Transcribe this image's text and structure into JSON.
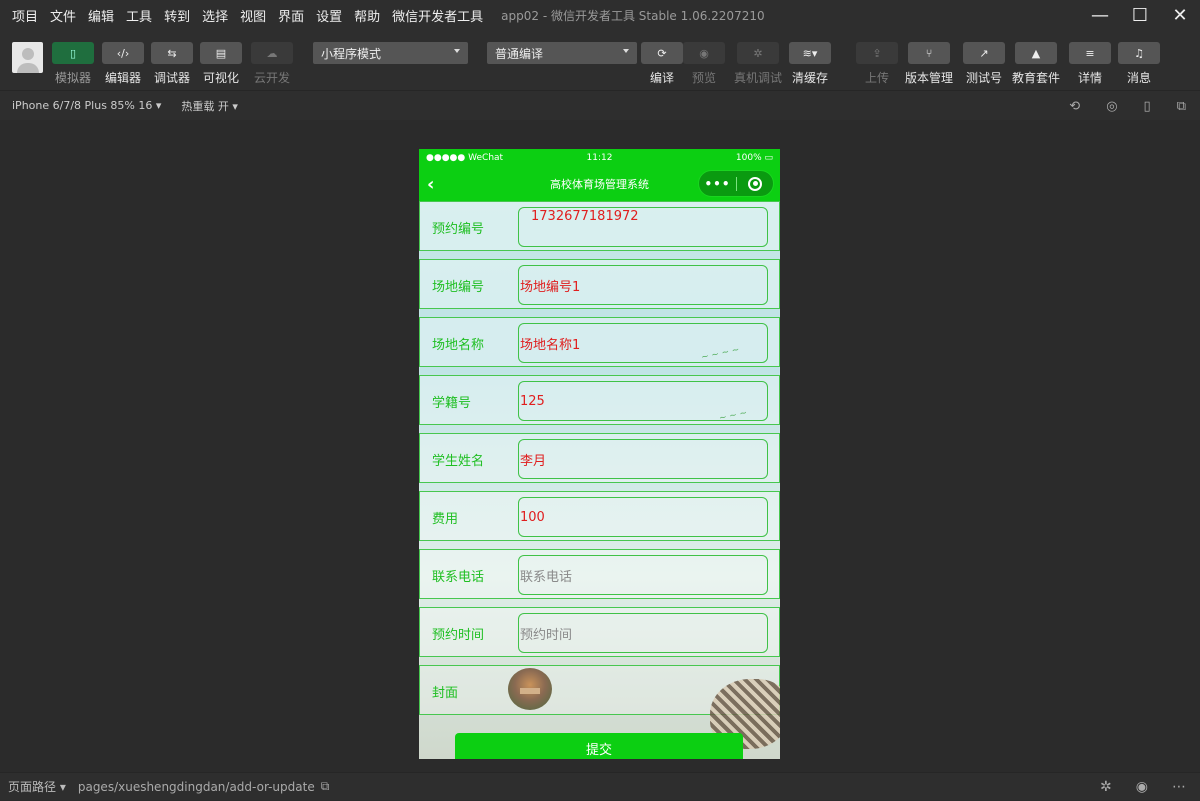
{
  "menubar": {
    "items": [
      "项目",
      "文件",
      "编辑",
      "工具",
      "转到",
      "选择",
      "视图",
      "界面",
      "设置",
      "帮助",
      "微信开发者工具"
    ],
    "title": "app02 - 微信开发者工具 Stable 1.06.2207210"
  },
  "window_controls": {
    "minimize": "—",
    "maximize": "☐",
    "close": "✕"
  },
  "toolbar": {
    "simulator": "模拟器",
    "editor": "编辑器",
    "debugger": "调试器",
    "visual": "可视化",
    "cloud": "云开发",
    "mode_select": "小程序模式",
    "compile_select": "普通编译",
    "compile": "编译",
    "preview": "预览",
    "remote_debug": "真机调试",
    "clear_cache": "清缓存",
    "upload": "上传",
    "version": "版本管理",
    "test_account": "测试号",
    "edu": "教育套件",
    "details": "详情",
    "messages": "消息"
  },
  "subbar": {
    "device": "iPhone 6/7/8 Plus 85% 16 ▾",
    "hot_reload": "热重载 开 ▾"
  },
  "phone": {
    "status": {
      "signal": "●●●●● WeChat",
      "time": "11:12",
      "battery": "100%"
    },
    "nav_title": "高校体育场管理系统",
    "form": [
      {
        "label": "预约编号",
        "value": "1732677181972",
        "placeholder": false
      },
      {
        "label": "场地编号",
        "value": "场地编号1",
        "placeholder": false
      },
      {
        "label": "场地名称",
        "value": "场地名称1",
        "placeholder": false
      },
      {
        "label": "学籍号",
        "value": "125",
        "placeholder": false
      },
      {
        "label": "学生姓名",
        "value": "李月",
        "placeholder": false
      },
      {
        "label": "费用",
        "value": "100",
        "placeholder": false
      },
      {
        "label": "联系电话",
        "value": "联系电话",
        "placeholder": true
      },
      {
        "label": "预约时间",
        "value": "预约时间",
        "placeholder": true
      }
    ],
    "cover_label": "封面",
    "submit": "提交"
  },
  "bottombar": {
    "path_label": "页面路径 ▾",
    "path": "pages/xueshengdingdan/add-or-update"
  },
  "colors": {
    "green": "#0ccf12",
    "label_green": "#1fbf22",
    "value_red": "#e01e1e"
  }
}
